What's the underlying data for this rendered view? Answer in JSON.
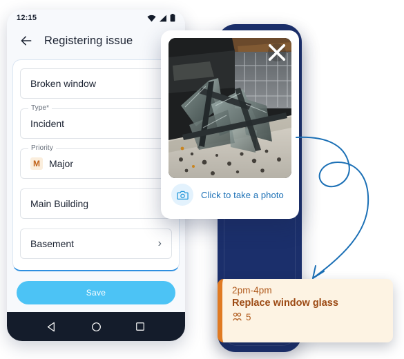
{
  "phone": {
    "status_bar": {
      "time": "12:15",
      "icons": [
        "wifi-icon",
        "signal-icon",
        "battery-icon"
      ]
    },
    "app_bar": {
      "back_icon": "back-arrow-icon",
      "title": "Registering issue"
    },
    "form": {
      "fields": [
        {
          "label": "",
          "value": "Broken window",
          "badge": "",
          "chevron": ""
        },
        {
          "label": "Type*",
          "value": "Incident",
          "badge": "",
          "chevron": ""
        },
        {
          "label": "Priority",
          "value": "Major",
          "badge": "M",
          "chevron": ""
        },
        {
          "label": "",
          "value": "Main Building",
          "badge": "",
          "chevron": ""
        },
        {
          "label": "",
          "value": "Basement",
          "badge": "",
          "chevron": "›"
        }
      ]
    },
    "save_label": "Save",
    "nav_bar": {
      "back": "nav-back-icon",
      "home": "nav-home-icon",
      "recents": "nav-recents-icon"
    }
  },
  "photo_card": {
    "close_icon": "close-icon",
    "image_alt": "broken-window-glass-photo",
    "camera_icon": "camera-icon",
    "cta_label": "Click to take a photo"
  },
  "task_note": {
    "time_range": "2pm-4pm",
    "title": "Replace window glass",
    "people_icon": "people-icon",
    "people_count": "5"
  },
  "decor": {
    "arrow_icon": "curved-arrow-icon"
  },
  "colors": {
    "accent_blue": "#4cc3f5",
    "link_blue": "#1a6fb5",
    "navy": "#1b2f6b",
    "note_bg": "#fdf3e3",
    "note_accent": "#e07a22",
    "note_text": "#9c4a14"
  }
}
